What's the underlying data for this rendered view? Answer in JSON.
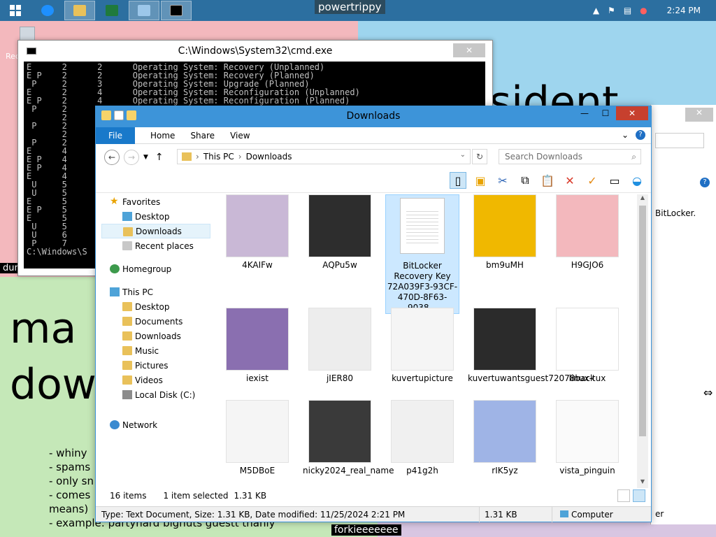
{
  "desktop": {
    "powertrippy_label": "powertrippy",
    "bg_text_sident": "sident",
    "bg_text_ma": "ma",
    "bg_text_dow": "dow",
    "bg_text_dur": "dur",
    "bullets": [
      "- whiny",
      "- spams",
      "- only sn",
      "- comes",
      "means)",
      "- example: partyhard bighuts guestt thanly"
    ],
    "bottom_label": "forkieeeeeee",
    "recycle_label": "Rec",
    "bitlocker_text": "BitLocker.",
    "er_text": "er"
  },
  "taskbar": {
    "clock": "2:24 PM",
    "items": [
      "start",
      "ie",
      "explorer",
      "excel",
      "remote",
      "cmd"
    ],
    "colors": {
      "bar": "#2c6fa0"
    }
  },
  "cmd": {
    "title": "C:\\Windows\\System32\\cmd.exe",
    "lines": [
      "E      2      2      Operating System: Recovery (Unplanned)",
      "E P    2      2      Operating System: Recovery (Planned)",
      " P     2      3      Operating System: Upgrade (Planned)",
      "E      2      4      Operating System: Reconfiguration (Unplanned)",
      "E P    2      4      Operating System: Reconfiguration (Planned)",
      " P     2      4",
      "       2",
      " P     2",
      "       2",
      " P     2",
      "E      4",
      "E P    4",
      "E P    4",
      "E      4",
      " U     5",
      " U     5",
      "E      5",
      "E P    5",
      "E      5",
      " U     5",
      " U     6",
      " P     7",
      "C:\\Windows\\S"
    ]
  },
  "explorer": {
    "title": "Downloads",
    "tabs": {
      "file": "File",
      "home": "Home",
      "share": "Share",
      "view": "View"
    },
    "address": {
      "part1": "This PC",
      "part2": "Downloads"
    },
    "search_placeholder": "Search Downloads",
    "nav": {
      "favorites": "Favorites",
      "desktop": "Desktop",
      "downloads": "Downloads",
      "recent": "Recent places",
      "homegroup": "Homegroup",
      "thispc": "This PC",
      "pc_desktop": "Desktop",
      "pc_documents": "Documents",
      "pc_downloads": "Downloads",
      "pc_music": "Music",
      "pc_pictures": "Pictures",
      "pc_videos": "Videos",
      "localdisk": "Local Disk (C:)",
      "network": "Network"
    },
    "files": [
      {
        "name": "4KAIFw",
        "color": "#c9b8d6"
      },
      {
        "name": "AQPu5w",
        "color": "#2d2d2d"
      },
      {
        "name": "BitLocker Recovery Key 72A039F3-93CF-470D-8F63-9038...",
        "color": "#ffffff"
      },
      {
        "name": "bm9uMH",
        "color": "#f0b800"
      },
      {
        "name": "H9GJO6",
        "color": "#f3b8bd"
      },
      {
        "name": "iexist",
        "color": "#8a6fb0"
      },
      {
        "name": "jIER80",
        "color": "#ededed"
      },
      {
        "name": "kuvertupicture",
        "color": "#f5f5f5"
      },
      {
        "name": "kuvertuwantsguest72078back",
        "color": "#2b2b2b"
      },
      {
        "name": "linux-tux",
        "color": "#ffffff"
      },
      {
        "name": "M5DBoE",
        "color": "#f5f5f5"
      },
      {
        "name": "nicky2024_real_name",
        "color": "#3a3a3a"
      },
      {
        "name": "p41g2h",
        "color": "#f0f0f0"
      },
      {
        "name": "rIK5yz",
        "color": "#9fb4e6"
      },
      {
        "name": "vista_pinguin",
        "color": "#fafafa"
      }
    ],
    "status": {
      "items": "16 items",
      "selected": "1 item selected",
      "size": "1.31 KB"
    },
    "statusbar": {
      "details": "Type: Text Document, Size: 1.31 KB, Date modified: 11/25/2024 2:21 PM",
      "size": "1.31 KB",
      "location": "Computer"
    }
  }
}
